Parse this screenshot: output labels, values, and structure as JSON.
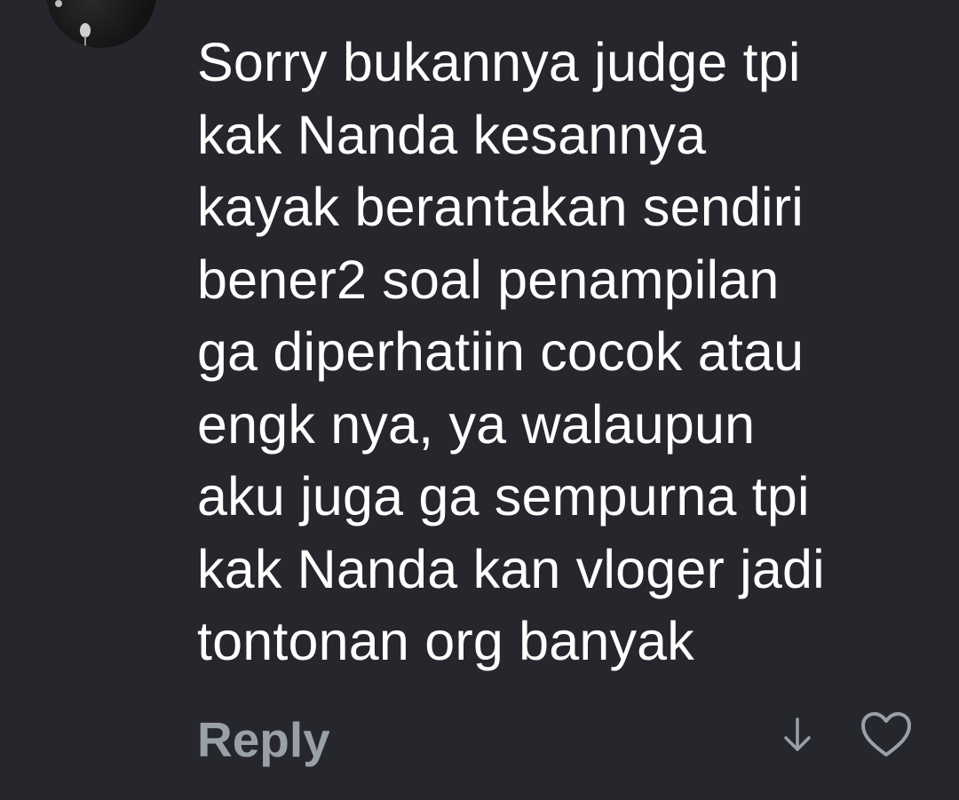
{
  "comment": {
    "lines": [
      "Sorry bukannya judge tpi",
      "kak Nanda kesannya",
      "kayak berantakan sendiri",
      "bener2 soal penampilan",
      "ga diperhatiin cocok atau",
      "engk nya, ya walaupun",
      "aku juga ga sempurna tpi",
      "kak Nanda kan vloger jadi",
      "tontonan org banyak"
    ]
  },
  "actions": {
    "reply_label": "Reply",
    "down_icon": "arrow-down-icon",
    "like_icon": "heart-outline-icon"
  },
  "colors": {
    "background": "#25272c",
    "text": "#ffffff",
    "muted": "#9aa0a8"
  }
}
